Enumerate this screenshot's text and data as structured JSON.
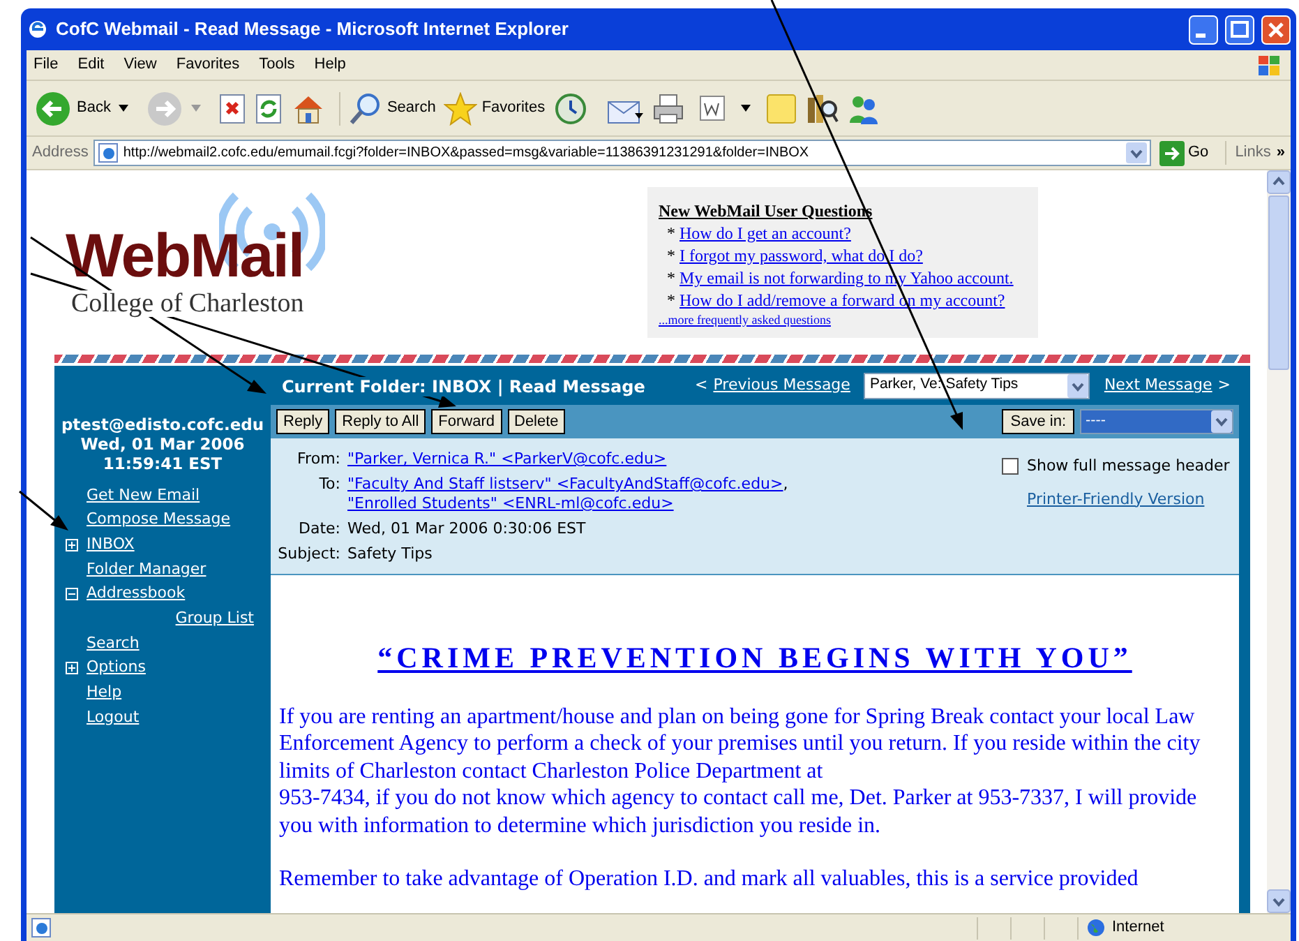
{
  "window": {
    "title": "CofC Webmail - Read Message - Microsoft Internet Explorer"
  },
  "menu_bar": [
    "File",
    "Edit",
    "View",
    "Favorites",
    "Tools",
    "Help"
  ],
  "toolbar": {
    "back": "Back",
    "search": "Search",
    "favorites": "Favorites"
  },
  "address_bar": {
    "label": "Address",
    "url": "http://webmail2.cofc.edu/emumail.fcgi?folder=INBOX&passed=msg&variable=11386391231291&folder=INBOX",
    "go": "Go",
    "links": "Links",
    "more": "»"
  },
  "logo": {
    "title": "WebMail",
    "subtitle": "College of Charleston"
  },
  "faq": {
    "heading": "New WebMail User Questions",
    "items": [
      "How do I get an account?",
      "I forgot my password, what do I do?",
      "My email is not forwarding to my Yahoo account.",
      "How do I add/remove a forward on my account?"
    ],
    "bullet": "*",
    "more": "...more frequently asked questions"
  },
  "folder_bar": {
    "title": "Current Folder: INBOX | Read Message",
    "prev_arrow": "<",
    "prev": "Previous Message",
    "message_select": "Parker, Ve: Safety Tips",
    "next": "Next Message",
    "next_arrow": ">"
  },
  "actions": [
    "Reply",
    "Reply to All",
    "Forward",
    "Delete"
  ],
  "save_in": {
    "label": "Save in:",
    "value": "----"
  },
  "sidebar": {
    "user": "ptest@edisto.cofc.edu",
    "date": "Wed, 01 Mar 2006",
    "time": "11:59:41 EST",
    "items": [
      {
        "label": "Get New Email"
      },
      {
        "label": "Compose Message"
      },
      {
        "label": "INBOX",
        "expanded": false
      },
      {
        "label": "Folder Manager"
      },
      {
        "label": "Addressbook",
        "expanded": true,
        "children": [
          {
            "label": "Group List"
          }
        ]
      },
      {
        "label": "Search"
      },
      {
        "label": "Options",
        "expanded": false
      },
      {
        "label": "Help"
      },
      {
        "label": "Logout"
      }
    ]
  },
  "headers": [
    {
      "label": "From:",
      "links": [
        "\"Parker, Vernica R.\" <ParkerV@cofc.edu>"
      ]
    },
    {
      "label": "To:",
      "links": [
        "\"Faculty And Staff listserv\" <FacultyAndStaff@cofc.edu>",
        "\"Enrolled Students\" <ENRL-ml@cofc.edu>"
      ],
      "separator": ","
    },
    {
      "label": "Date:",
      "value": "Wed, 01 Mar 2006 0:30:06 EST"
    },
    {
      "label": "Subject:",
      "value": "Safety Tips"
    }
  ],
  "show_full_header": {
    "label": "Show full message header",
    "checked": false
  },
  "printer_link": "Printer-Friendly Version",
  "message": {
    "title": "“CRIME PREVENTION BEGINS WITH YOU”",
    "paragraphs": [
      "If you are renting an apartment/house and plan on being gone for Spring Break contact your local Law Enforcement Agency to perform a check of your premises until you return.  If you reside within the city limits of Charleston contact Charleston Police Department at\n953-7434, if you do not know which agency to contact call me, Det. Parker at 953-7337, I will provide you with information to determine which jurisdiction you reside in.",
      "Remember to take advantage of Operation I.D. and mark all valuables, this is a service provided"
    ]
  },
  "status_bar": {
    "zone": "Internet"
  }
}
